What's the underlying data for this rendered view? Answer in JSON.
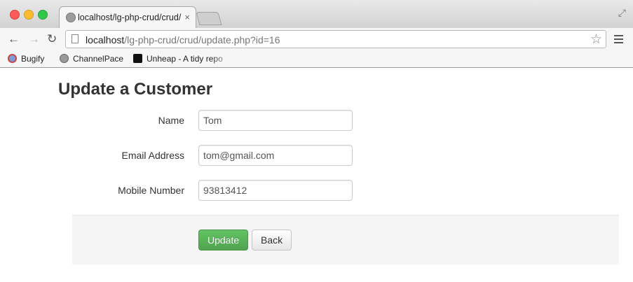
{
  "browser": {
    "tab_title": "localhost/lg-php-crud/crud/",
    "tab_close": "×",
    "url_host": "localhost",
    "url_path": "/lg-php-crud/crud/update.php?id=16",
    "bookmarks": [
      "Bugify",
      "ChannelPace",
      "Unheap - A tidy repo"
    ]
  },
  "page": {
    "title": "Update a Customer",
    "fields": [
      {
        "label": "Name",
        "value": "Tom"
      },
      {
        "label": "Email Address",
        "value": "tom@gmail.com"
      },
      {
        "label": "Mobile Number",
        "value": "93813412"
      }
    ],
    "update_label": "Update",
    "back_label": "Back"
  },
  "colors": {
    "update_button": "#5bb75b",
    "page_title": "#333333"
  }
}
